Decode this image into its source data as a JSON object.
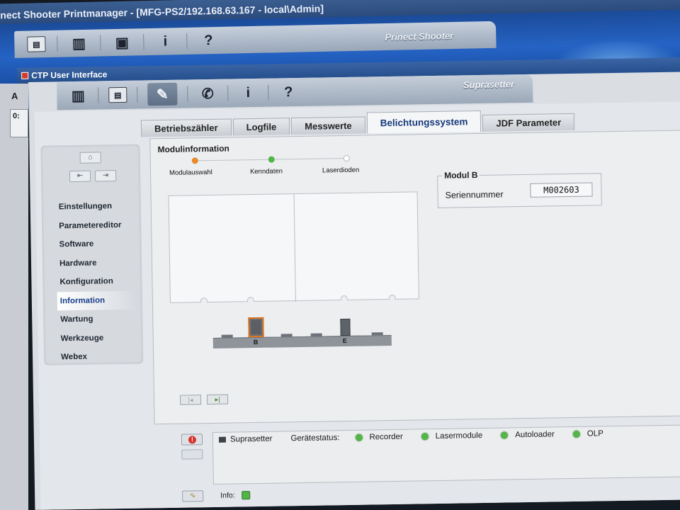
{
  "outer_window": {
    "title": "nect Shooter Printmanager - [MFG-PS2/192.168.63.167 - local\\Admin]",
    "brand": "Prinect Shooter",
    "toolbar": {
      "info_label": "i",
      "help_label": "?"
    },
    "left_letter": "A",
    "left_box_text": "0:"
  },
  "ctp_window": {
    "title": "CTP User Interface",
    "brand": "Suprasetter",
    "toolbar": {
      "info_label": "i",
      "help_label": "?"
    }
  },
  "tabs": [
    {
      "label": "Betriebszähler"
    },
    {
      "label": "Logfile"
    },
    {
      "label": "Messwerte"
    },
    {
      "label": "Belichtungssystem",
      "active": true
    },
    {
      "label": "JDF Parameter"
    }
  ],
  "nav": {
    "items": [
      {
        "label": "Einstellungen"
      },
      {
        "label": "Parametereditor"
      },
      {
        "label": "Software"
      },
      {
        "label": "Hardware"
      },
      {
        "label": "Konfiguration"
      },
      {
        "label": "Information",
        "active": true
      },
      {
        "label": "Wartung"
      },
      {
        "label": "Werkzeuge"
      },
      {
        "label": "Webex"
      }
    ]
  },
  "modul_info": {
    "title": "Modulinformation",
    "steps": [
      {
        "label": "Modulauswahl",
        "state": "current",
        "color": "#e8892a"
      },
      {
        "label": "Kenndaten",
        "state": "done",
        "color": "#53b447"
      },
      {
        "label": "Laserdioden",
        "state": "pending",
        "color": "#ffffff"
      }
    ],
    "rail_labels": {
      "b": "B",
      "e": "E"
    }
  },
  "modul_b": {
    "legend": "Modul B",
    "serial_label": "Seriennummer",
    "serial_value": "M002603"
  },
  "status": {
    "device": "Suprasetter",
    "geraetestatus_label": "Gerätestatus:",
    "indicators": [
      {
        "label": "Recorder",
        "color": "#54b44a"
      },
      {
        "label": "Lasermodule",
        "color": "#54b44a"
      },
      {
        "label": "Autoloader",
        "color": "#54b44a"
      },
      {
        "label": "OLP",
        "color": "#54b44a"
      }
    ],
    "info_label": "Info:"
  }
}
